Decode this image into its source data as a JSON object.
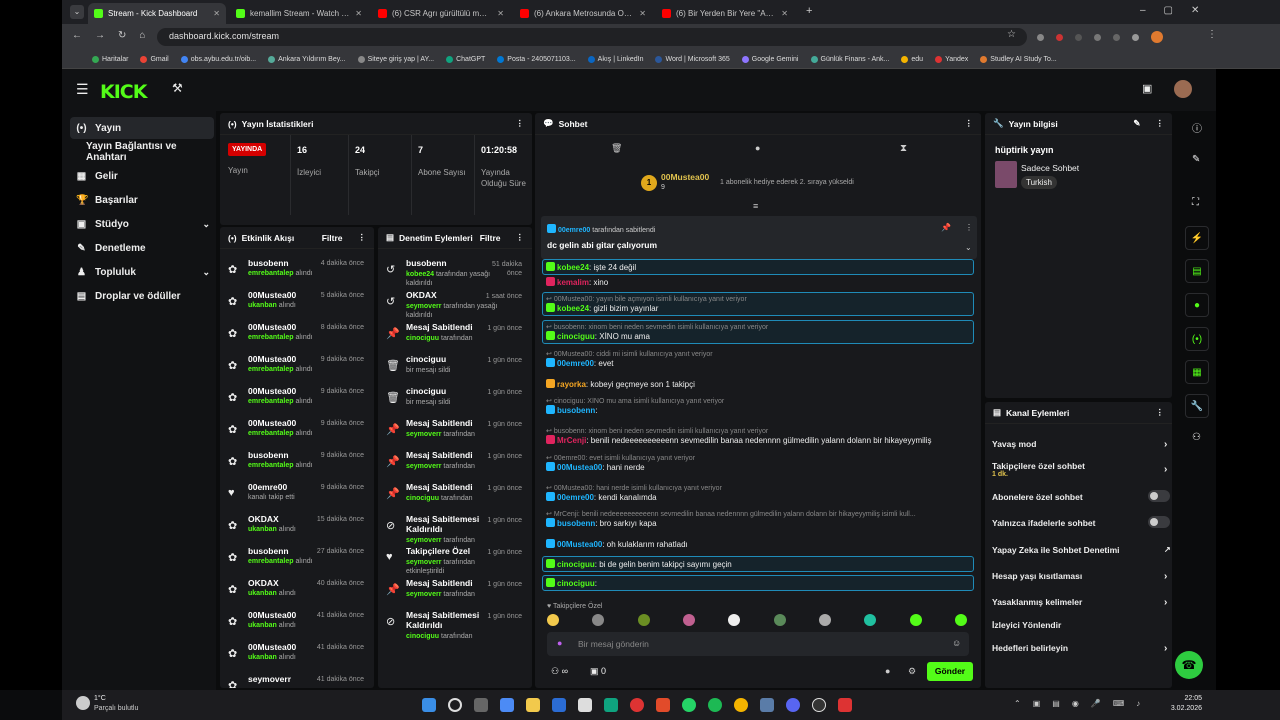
{
  "browser": {
    "tabs": [
      {
        "label": "Stream - Kick Dashboard",
        "color": "#53fc18"
      },
      {
        "label": "kemallim Stream - Watch Live o",
        "color": "#53fc18"
      },
      {
        "label": "(6) CSR Agrı gürültülü motor s",
        "color": "#ff0000"
      },
      {
        "label": "(6) Ankara Metrosunda OSB Tö",
        "color": "#ff0000"
      },
      {
        "label": "(6) Bir Yerden Bir Yere \"Ankara\"",
        "color": "#ff0000"
      }
    ],
    "url": "dashboard.kick.com/stream",
    "bookmarks": [
      "Haritalar",
      "Gmail",
      "obs.aybu.edu.tr/oib...",
      "Ankara Yıldırım Bey...",
      "Siteye giriş yap | AY...",
      "ChatGPT",
      "Posta - 2405071103...",
      "Akış | LinkedIn",
      "Word | Microsoft 365",
      "Google Gemini",
      "Günlük Finans - Ank...",
      "edu",
      "Yandex",
      "Studley AI Study To..."
    ]
  },
  "logo": "KICK",
  "sidebar": {
    "items": [
      {
        "label": "Yayın",
        "icon": "(•)"
      },
      {
        "label": "Yayın Bağlantısı ve Anahtarı",
        "icon": ""
      },
      {
        "label": "Gelir",
        "icon": "▦"
      },
      {
        "label": "Başarılar",
        "icon": "🏆"
      },
      {
        "label": "Stüdyo",
        "icon": "▣"
      },
      {
        "label": "Denetleme",
        "icon": "✎"
      },
      {
        "label": "Topluluk",
        "icon": "♟"
      },
      {
        "label": "Droplar ve ödüller",
        "icon": "▤"
      }
    ]
  },
  "stats": {
    "title": "Yayın İstatistikleri",
    "live_badge": "YAYINDA",
    "items": [
      {
        "value": "",
        "label": "Yayın"
      },
      {
        "value": "16",
        "label": "İzleyici"
      },
      {
        "value": "24",
        "label": "Takipçi"
      },
      {
        "value": "7",
        "label": "Abone Sayısı"
      },
      {
        "value": "01:20:58",
        "label": "Yayında Olduğu Süre"
      }
    ]
  },
  "activity": {
    "title": "Etkinlik Akışı",
    "filter": "Filtre",
    "rows": [
      {
        "name": "busobenn",
        "by": "emrebantalep",
        "suffix": "alındı",
        "time": "4 dakika önce"
      },
      {
        "name": "00Mustea00",
        "by": "ukanban",
        "suffix": "alındı",
        "time": "5 dakika önce"
      },
      {
        "name": "00Mustea00",
        "by": "emrebantalep",
        "suffix": "alındı",
        "time": "8 dakika önce"
      },
      {
        "name": "00Mustea00",
        "by": "emrebantalep",
        "suffix": "alındı",
        "time": "9 dakika önce"
      },
      {
        "name": "00Mustea00",
        "by": "emrebantalep",
        "suffix": "alındı",
        "time": "9 dakika önce"
      },
      {
        "name": "00Mustea00",
        "by": "emrebantalep",
        "suffix": "alındı",
        "time": "9 dakika önce"
      },
      {
        "name": "busobenn",
        "by": "emrebantalep",
        "suffix": "alındı",
        "time": "9 dakika önce"
      },
      {
        "name": "00emre00",
        "by": "",
        "suffix": "kanalı takip etti",
        "time": "9 dakika önce"
      },
      {
        "name": "OKDAX",
        "by": "ukanban",
        "suffix": "alındı",
        "time": "15 dakika önce"
      },
      {
        "name": "busobenn",
        "by": "emrebantalep",
        "suffix": "alındı",
        "time": "27 dakika önce"
      },
      {
        "name": "OKDAX",
        "by": "ukanban",
        "suffix": "alındı",
        "time": "40 dakika önce"
      },
      {
        "name": "00Mustea00",
        "by": "ukanban",
        "suffix": "alındı",
        "time": "41 dakika önce"
      },
      {
        "name": "00Mustea00",
        "by": "ukanban",
        "suffix": "alındı",
        "time": "41 dakika önce"
      },
      {
        "name": "seymoverr",
        "by": "",
        "suffix": "",
        "time": "41 dakika önce"
      }
    ]
  },
  "moderation": {
    "title": "Denetim Eylemleri",
    "filter": "Filtre",
    "rows": [
      {
        "name": "busobenn",
        "by": "kobee24",
        "suffix": "tarafından yasağı kaldırıldı",
        "time": "51 dakika önce"
      },
      {
        "name": "OKDAX",
        "by": "seymoverr",
        "suffix": "tarafından yasağı kaldırıldı",
        "time": "1 saat önce"
      },
      {
        "name": "Mesaj Sabitlendi",
        "by": "cinociguu",
        "suffix": "tarafından",
        "time": "1 gün önce"
      },
      {
        "name": "cinociguu",
        "by": "",
        "suffix": "bir mesajı sildi",
        "time": "1 gün önce"
      },
      {
        "name": "cinociguu",
        "by": "",
        "suffix": "bir mesajı sildi",
        "time": "1 gün önce"
      },
      {
        "name": "Mesaj Sabitlendi",
        "by": "seymoverr",
        "suffix": "tarafından",
        "time": "1 gün önce"
      },
      {
        "name": "Mesaj Sabitlendi",
        "by": "seymoverr",
        "suffix": "tarafından",
        "time": "1 gün önce"
      },
      {
        "name": "Mesaj Sabitlendi",
        "by": "cinociguu",
        "suffix": "tarafından",
        "time": "1 gün önce"
      },
      {
        "name": "Mesaj Sabitlemesi Kaldırıldı",
        "by": "seymoverr",
        "suffix": "tarafından",
        "time": "1 gün önce"
      },
      {
        "name": "Takipçilere Özel",
        "by": "seymoverr",
        "suffix": "tarafından etkinleştirildi",
        "time": "1 gün önce"
      },
      {
        "name": "Mesaj Sabitlendi",
        "by": "seymoverr",
        "suffix": "tarafından",
        "time": "1 gün önce"
      },
      {
        "name": "Mesaj Sabitlemesi Kaldırıldı",
        "by": "cinociguu",
        "suffix": "tarafından",
        "time": "1 gün önce"
      }
    ]
  },
  "chat": {
    "title": "Sohbet",
    "gift_user": "00Mustea00",
    "gift_count": "9",
    "gift_text": "1 abonelik hediye ederek 2. sıraya yükseldi",
    "pinned_by": "00emre00",
    "pinned_suffix": "tarafından sabitlendi",
    "pinned_text": "dc gelin abi gitar çalıyorum",
    "messages": [
      {
        "reply": "",
        "user": "kobee24",
        "ucolor": "#53fc18",
        "text": ": işte 24 değil",
        "hl": true
      },
      {
        "reply": "",
        "user": "kemalim",
        "ucolor": "#e0245e",
        "text": ": xino",
        "hl": false
      },
      {
        "reply": "00Mustea00: yayın bile açmıyon isimli kullanıcıya yanıt veriyor",
        "user": "kobee24",
        "ucolor": "#53fc18",
        "text": ": gizli bizim yayınlar",
        "hl": true
      },
      {
        "reply": "busobenn: xinom beni neden sevmedin isimli kullanıcıya yanıt veriyor",
        "user": "cinociguu",
        "ucolor": "#53fc18",
        "text": ": XİNO mu ama",
        "hl": true
      },
      {
        "reply": "00Mustea00: ciddi mi isimli kullanıcıya yanıt veriyor",
        "user": "00emre00",
        "ucolor": "#1fb6ff",
        "text": ": evet",
        "hl": false
      },
      {
        "reply": "",
        "user": "rayorka",
        "ucolor": "#f5a623",
        "text": ": kobeyi geçmeye son 1 takipçi",
        "hl": false
      },
      {
        "reply": "cinociguu: XİNO mu ama isimli kullanıcıya yanıt veriyor",
        "user": "busobenn",
        "ucolor": "#1fb6ff",
        "text": ":",
        "hl": false
      },
      {
        "reply": "busobenn: xinom beni neden sevmedin isimli kullanıcıya yanıt veriyor",
        "user": "MrCenji",
        "ucolor": "#e0245e",
        "text": ": benili nedeeeeeeeeeenn sevmedilin banaa nedennnn gülmedilin yalann dolann bir hikayeyymiliş",
        "hl": false
      },
      {
        "reply": "00emre00: evet isimli kullanıcıya yanıt veriyor",
        "user": "00Mustea00",
        "ucolor": "#1fb6ff",
        "text": ": hani nerde",
        "hl": false
      },
      {
        "reply": "00Mustea00: hani nerde isimli kullanıcıya yanıt veriyor",
        "user": "00emre00",
        "ucolor": "#1fb6ff",
        "text": ": kendi kanalımda",
        "hl": false
      },
      {
        "reply": "MrCenji: benili nedeeeeeeeeeenn sevmedilin banaa nedennnn gülmedilin yalann dolann bir hikayeyymiliş isimli kull...",
        "user": "busobenn",
        "ucolor": "#1fb6ff",
        "text": ": bro sarkıyı kapa",
        "hl": false
      },
      {
        "reply": "",
        "user": "00Mustea00",
        "ucolor": "#1fb6ff",
        "text": ": oh kulaklarım rahatladı",
        "hl": false
      },
      {
        "reply": "",
        "user": "cinociguu",
        "ucolor": "#53fc18",
        "text": ": bi de gelin benim takipçi sayımı geçin",
        "hl": true
      },
      {
        "reply": "",
        "user": "cinociguu",
        "ucolor": "#53fc18",
        "text": ":",
        "hl": true
      }
    ],
    "mode_label": "Takipçilere Özel",
    "input_placeholder": "Bir mesaj gönderin",
    "send": "Gönder",
    "viewers_icon": "∞",
    "count": "0"
  },
  "streaminfo": {
    "title": "Yayın bilgisi",
    "stream_title": "hüptirik yayın",
    "category": "Sadece Sohbet",
    "tag": "Turkish"
  },
  "channel_actions": {
    "title": "Kanal Eylemleri",
    "items": [
      {
        "label": "Yavaş mod",
        "sub": "",
        "ctl": "chev"
      },
      {
        "label": "Takipçilere özel sohbet",
        "sub": "1 dk.",
        "ctl": "chev"
      },
      {
        "label": "Abonelere özel sohbet",
        "sub": "",
        "ctl": "toggle"
      },
      {
        "label": "Yalnızca ifadelerle sohbet",
        "sub": "",
        "ctl": "toggle"
      },
      {
        "label": "Yapay Zeka ile Sohbet Denetimi",
        "sub": "",
        "ctl": "ext"
      },
      {
        "label": "Hesap yaşı kısıtlaması",
        "sub": "",
        "ctl": "chev"
      },
      {
        "label": "Yasaklanmış kelimeler",
        "sub": "",
        "ctl": "chev"
      },
      {
        "label": "İzleyici Yönlendir",
        "sub": "",
        "ctl": ""
      },
      {
        "label": "Hedefleri belirleyin",
        "sub": "",
        "ctl": "chev"
      }
    ]
  },
  "taskbar": {
    "weather_temp": "1°C",
    "weather_text": "Parçalı bulutlu",
    "time": "22:05",
    "date": "3.02.2026"
  }
}
